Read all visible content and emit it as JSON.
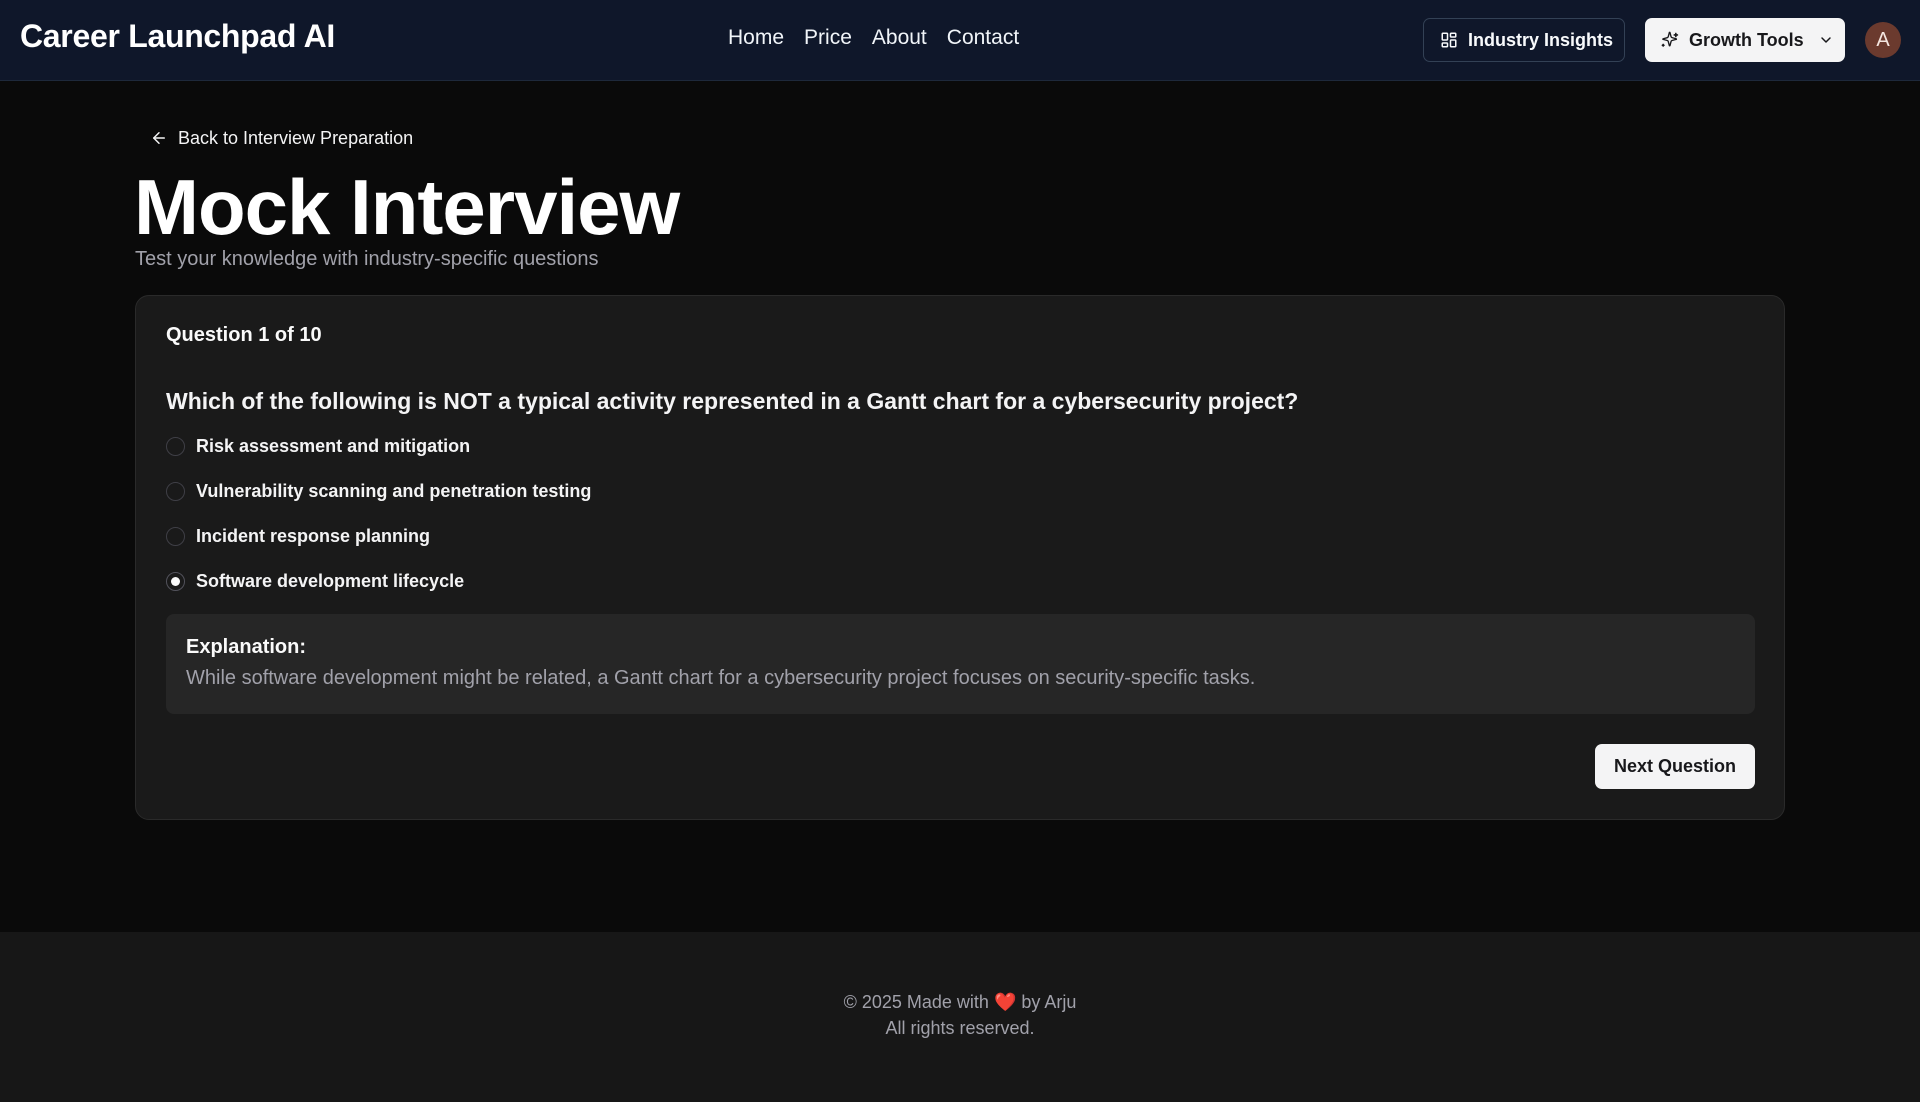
{
  "header": {
    "brand": "Career Launchpad AI",
    "nav": [
      "Home",
      "Price",
      "About",
      "Contact"
    ],
    "industry_insights_label": "Industry Insights",
    "growth_tools_label": "Growth Tools",
    "avatar_initial": "A",
    "icons": {
      "industry_insights": "layout-dashboard-icon",
      "growth_tools": "stars-icon",
      "dropdown": "chevron-down-icon"
    }
  },
  "main": {
    "back_link": "Back to Interview Preparation",
    "title": "Mock Interview",
    "subtitle": "Test your knowledge with industry-specific questions"
  },
  "quiz": {
    "counter": "Question 1 of 10",
    "question": "Which of the following is NOT a typical activity represented in a Gantt chart for a cybersecurity project?",
    "options": [
      "Risk assessment and mitigation",
      "Vulnerability scanning and penetration testing",
      "Incident response planning",
      "Software development lifecycle"
    ],
    "selected_index": 3,
    "explanation_title": "Explanation:",
    "explanation_body": "While software development might be related, a Gantt chart for a cybersecurity project focuses on security-specific tasks.",
    "next_label": "Next Question"
  },
  "footer": {
    "line1_prefix": "© 2025 Made with",
    "heart": "❤️",
    "line1_suffix": "by Arju",
    "line2": "All rights reserved."
  },
  "colors": {
    "header_bg": "#0f172a",
    "page_bg": "#0a0a0a",
    "card_bg": "#1a1a1a",
    "accent_light": "#f4f4f5",
    "avatar_bg": "#6b3a2e"
  }
}
